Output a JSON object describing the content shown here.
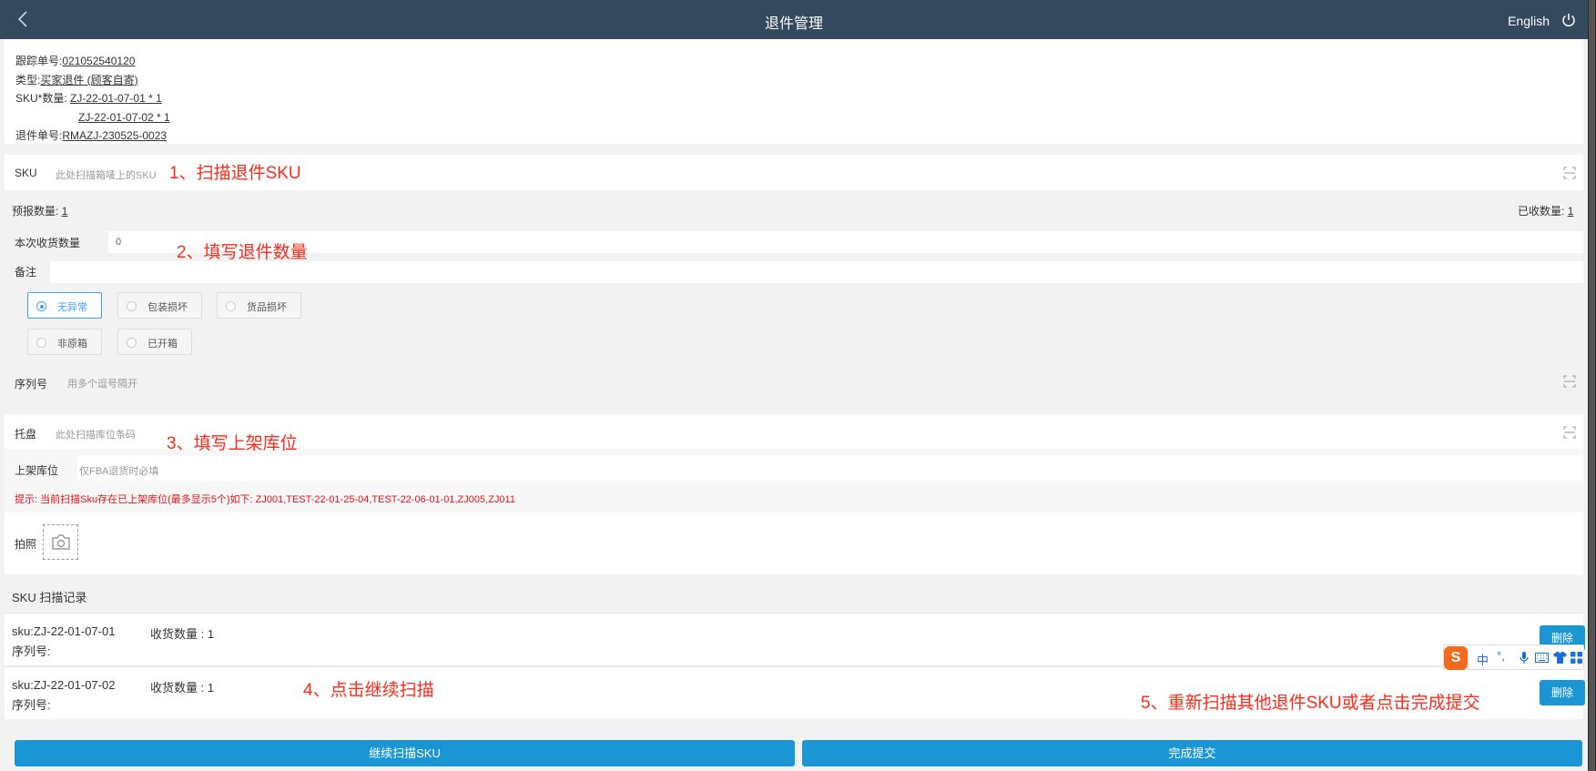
{
  "header": {
    "title": "退件管理",
    "language": "English"
  },
  "info": {
    "tracking_label": "跟踪单号:",
    "tracking_value": "021052540120",
    "type_label": "类型:",
    "type_value": "买家退件 (顾客自寄)",
    "sku_label": "SKU*数量:",
    "sku_values": [
      "ZJ-22-01-07-01 * 1",
      "ZJ-22-01-07-02 * 1"
    ],
    "return_no_label": "退件单号:",
    "return_no_value": "RMAZJ-230525-0023"
  },
  "sku_field": {
    "label": "SKU",
    "placeholder": "此处扫描箱唛上的SKU"
  },
  "forecast": {
    "label": "预报数量:",
    "value": "1"
  },
  "received": {
    "label": "已收数量:",
    "value": "1"
  },
  "qty_field": {
    "label": "本次收货数量",
    "value": "0"
  },
  "remark_field": {
    "label": "备注"
  },
  "conditions": [
    {
      "label": "无异常",
      "selected": true
    },
    {
      "label": "包装损坏",
      "selected": false
    },
    {
      "label": "货品损坏",
      "selected": false
    },
    {
      "label": "非原箱",
      "selected": false
    },
    {
      "label": "已开箱",
      "selected": false
    }
  ],
  "serial_field": {
    "label": "序列号",
    "placeholder": "用多个逗号隔开"
  },
  "pallet_field": {
    "label": "托盘",
    "placeholder": "此处扫描库位条码"
  },
  "shelf_field": {
    "label": "上架库位",
    "placeholder": "仅FBA退货时必填"
  },
  "hint": "提示: 当前扫描Sku存在已上架库位(最多显示5个)如下: ZJ001,TEST-22-01-25-04,TEST-22-06-01-01,ZJ005,ZJ011",
  "photo": {
    "label": "拍照"
  },
  "records": {
    "title": "SKU 扫描记录",
    "items": [
      {
        "sku": "sku:ZJ-22-01-07-01",
        "qty": "收货数量 : 1",
        "serial": "序列号:",
        "delete": "删除"
      },
      {
        "sku": "sku:ZJ-22-01-07-02",
        "qty": "收货数量 : 1",
        "serial": "序列号:",
        "delete": "删除"
      }
    ]
  },
  "buttons": {
    "continue_scan": "继续扫描SKU",
    "submit": "完成提交"
  },
  "annotations": {
    "step1": "1、扫描退件SKU",
    "step2": "2、填写退件数量",
    "step3": "3、填写上架库位",
    "step4": "4、点击继续扫描",
    "step5": "5、重新扫描其他退件SKU或者点击完成提交"
  },
  "ime_toolbar": {
    "logo": "S",
    "mode": "中",
    "punct": "°,"
  },
  "colors": {
    "header": "#34495e",
    "primary": "#1a96d4",
    "selected": "#409eff",
    "annotation": "#ff2a1a",
    "hint": "#e8101a"
  }
}
